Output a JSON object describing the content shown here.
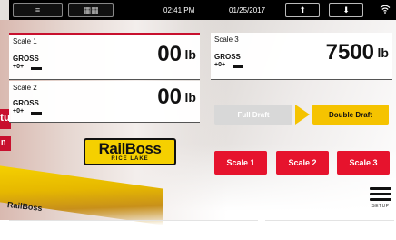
{
  "topbar": {
    "menu_icon": "menu-icon",
    "grid_icon": "grid-icon",
    "time": "02:41 PM",
    "date": "01/25/2017",
    "up_icon": "arrow-up-icon",
    "down_icon": "arrow-down-icon",
    "wifi_icon": "wifi-icon"
  },
  "scales": [
    {
      "name": "Scale 1",
      "value": "00",
      "unit": "lb",
      "mode": "GROSS",
      "indicators": [
        "+0+",
        "stable"
      ]
    },
    {
      "name": "Scale 2",
      "value": "00",
      "unit": "lb",
      "mode": "GROSS",
      "indicators": [
        "+0+",
        "stable"
      ]
    },
    {
      "name": "Scale 3",
      "value": "7500",
      "unit": "lb",
      "mode": "GROSS",
      "indicators": [
        "+0+",
        "stable"
      ]
    }
  ],
  "logo": {
    "main": "RailBoss",
    "sub": "RICE LAKE"
  },
  "background": {
    "left_tab_1": "tu",
    "left_tab_2": "n",
    "beam_label": "RailBoss"
  },
  "draft": {
    "full_label": "Full Draft",
    "double_label": "Double Draft"
  },
  "scale_buttons": [
    "Scale 1",
    "Scale 2",
    "Scale 3"
  ],
  "setup": {
    "label": "SETUP",
    "icon": "hamburger-icon"
  },
  "colors": {
    "accent_red": "#e6132d",
    "draft_yellow": "#f5c300",
    "disabled_gray": "#d8d8d8",
    "topbar_black": "#000000"
  }
}
